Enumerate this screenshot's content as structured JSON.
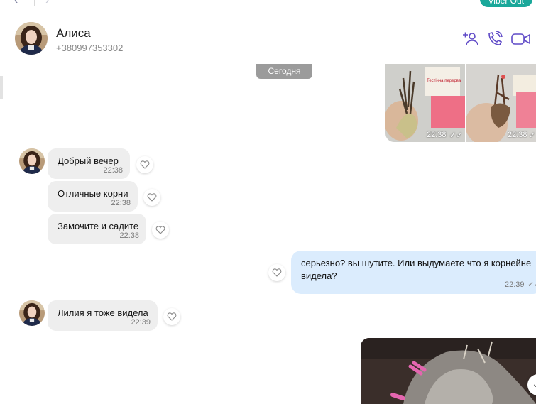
{
  "topbar": {
    "back_icon": "chevron-left-icon",
    "forward_icon": "chevron-right-icon",
    "viber_out_label": "Viber Out"
  },
  "contact": {
    "name": "Алиса",
    "phone": "+380997353302"
  },
  "header_actions": [
    {
      "name": "add-participant-icon"
    },
    {
      "name": "call-icon"
    },
    {
      "name": "video-call-icon"
    }
  ],
  "date_separator": "Сегодня",
  "photos_top": [
    {
      "time": "22:38",
      "photo_label": "Тестічна перерва"
    },
    {
      "time": "22:38",
      "photo_label": ""
    }
  ],
  "incoming_group_1": [
    {
      "text": "Добрый вечер",
      "time": "22:38"
    },
    {
      "text": "Отличные корни",
      "time": "22:38"
    },
    {
      "text": "Замочите и садите",
      "time": "22:38"
    }
  ],
  "outgoing_1": {
    "text": "серьезно? вы шутите. Или выдумаете что  я корнейне видела?",
    "time": "22:39"
  },
  "incoming_2": {
    "text": "Лилия я тоже видела",
    "time": "22:39"
  },
  "colors": {
    "accent": "#5f4ac7",
    "viber_out": "#1aa89a",
    "incoming_bubble": "#eeeeee",
    "outgoing_bubble": "#dbecfd",
    "date_pill": "#9b9b9b"
  }
}
